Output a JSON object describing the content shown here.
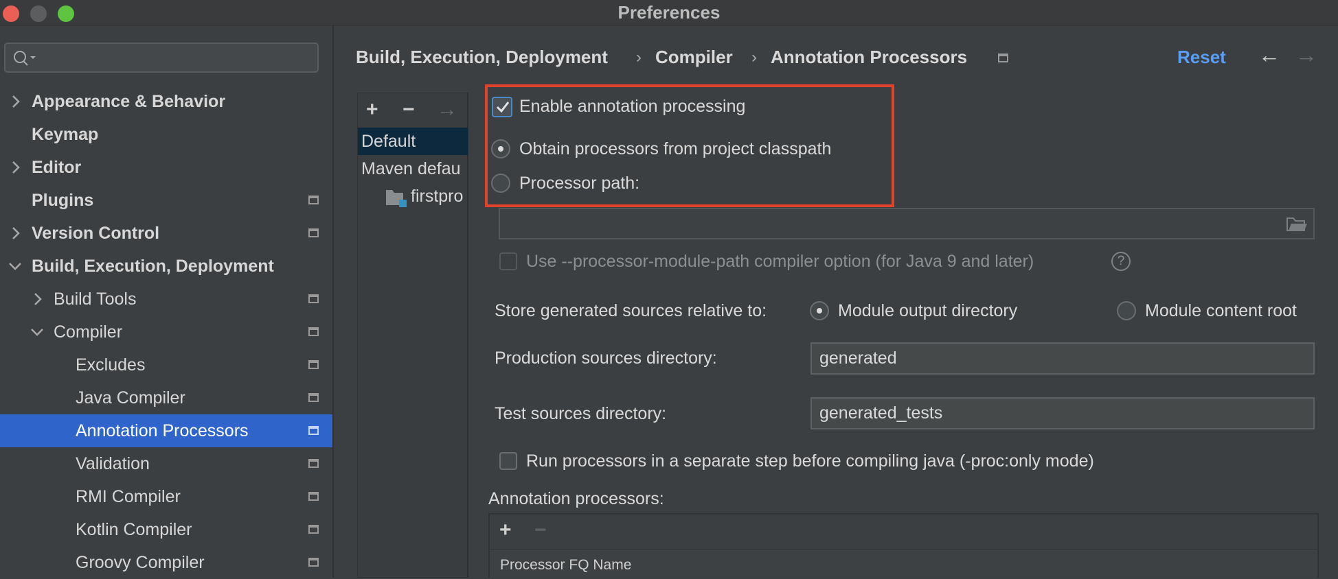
{
  "window": {
    "title": "Preferences"
  },
  "search": {
    "placeholder": ""
  },
  "sidebar": {
    "items": [
      {
        "label": "Appearance & Behavior"
      },
      {
        "label": "Keymap"
      },
      {
        "label": "Editor"
      },
      {
        "label": "Plugins"
      },
      {
        "label": "Version Control"
      },
      {
        "label": "Build, Execution, Deployment"
      },
      {
        "label": "Build Tools"
      },
      {
        "label": "Compiler"
      },
      {
        "label": "Excludes"
      },
      {
        "label": "Java Compiler"
      },
      {
        "label": "Annotation Processors"
      },
      {
        "label": "Validation"
      },
      {
        "label": "RMI Compiler"
      },
      {
        "label": "Kotlin Compiler"
      },
      {
        "label": "Groovy Compiler"
      }
    ]
  },
  "breadcrumb": {
    "items": [
      "Build, Execution, Deployment",
      "Compiler",
      "Annotation Processors"
    ],
    "separator": "›"
  },
  "header": {
    "reset_label": "Reset",
    "back_icon": "←",
    "forward_icon": "→"
  },
  "profiles": {
    "toolbar": {
      "add": "+",
      "remove": "−",
      "move": "→"
    },
    "items": [
      "Default",
      "Maven defau",
      "firstpro"
    ],
    "selected": "Default"
  },
  "form": {
    "enable_label": "Enable annotation processing",
    "enable_checked": true,
    "obtain_label": "Obtain processors from project classpath",
    "processor_path_label": "Processor path:",
    "processor_path_value": "",
    "module_path_label": "Use --processor-module-path compiler option (for Java 9 and later)",
    "help_icon": "?",
    "store_label": "Store generated sources relative to:",
    "module_output_label": "Module output directory",
    "module_content_label": "Module content root",
    "production_label": "Production sources directory:",
    "production_value": "generated",
    "test_label": "Test sources directory:",
    "test_value": "generated_tests",
    "run_separate_label": "Run processors in a separate step before compiling java (-proc:only mode)",
    "annotation_processors_label": "Annotation processors:",
    "ap_add": "+",
    "ap_remove": "−",
    "ap_column": "Processor FQ Name"
  },
  "colors": {
    "accent": "#2f65ca",
    "highlight": "#e0422d",
    "link": "#589df6"
  }
}
